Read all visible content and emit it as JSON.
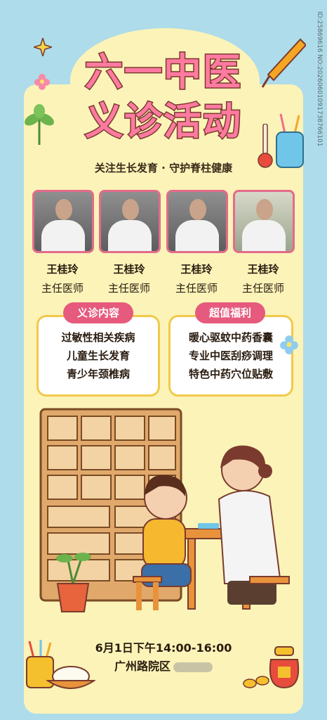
{
  "title": {
    "line1": "六一中医",
    "line2": "义诊活动"
  },
  "subtitle": "关注生长发育 · 守护脊柱健康",
  "doctors": [
    {
      "name": "王桂玲",
      "title": "主任医师"
    },
    {
      "name": "王桂玲",
      "title": "主任医师"
    },
    {
      "name": "王桂玲",
      "title": "主任医师"
    },
    {
      "name": "王桂玲",
      "title": "主任医师"
    }
  ],
  "services": {
    "label": "义诊内容",
    "items": [
      "过敏性相关疾病",
      "儿童生长发育",
      "青少年颈椎病"
    ]
  },
  "benefits": {
    "label": "超值福利",
    "items": [
      "暖心驱蚊中药香囊",
      "专业中医刮痧调理",
      "特色中药穴位贴敷"
    ]
  },
  "event": {
    "datetime": "6月1日下午14:00-16:00",
    "location": "广州路院区"
  },
  "watermark": "ID:25869616 NO:20260601091738766101",
  "colors": {
    "background": "#aedcea",
    "panel": "#fbf3b8",
    "title": "#ff7aa0",
    "tag": "#e65a7d",
    "box_border": "#f2c94a"
  }
}
